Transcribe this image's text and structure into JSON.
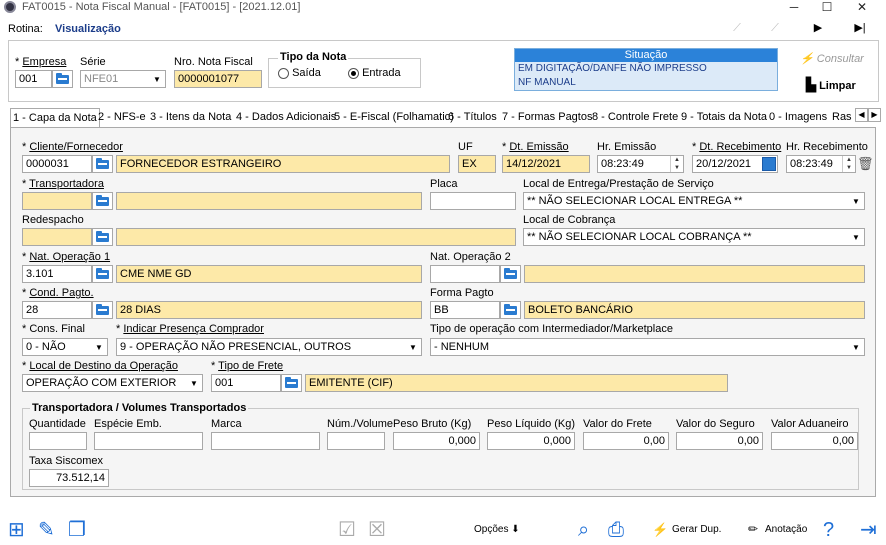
{
  "window": {
    "title": "FAT0015 - Nota Fiscal Manual - [FAT0015] - [2021.12.01]",
    "minimize": "─",
    "maximize": "☐",
    "close": "✕"
  },
  "rotina": {
    "label": "Rotina:",
    "value": "Visualização"
  },
  "nav": [
    "⟋",
    "⟋",
    "▶",
    "▶|"
  ],
  "header": {
    "empresa": {
      "label": "Empresa",
      "value": "001"
    },
    "serie": {
      "label": "Série",
      "value": "NFE01"
    },
    "nro": {
      "label": "Nro. Nota Fiscal",
      "value": "0000001077"
    },
    "tipo": {
      "title": "Tipo da Nota",
      "saida": "Saída",
      "entrada": "Entrada",
      "selected": "entrada"
    },
    "situacao": {
      "title": "Situação",
      "lines": [
        "EM DIGITAÇÃO/DANFE NÃO IMPRESSO",
        "NF MANUAL"
      ]
    },
    "consultar": "Consultar",
    "limpar": "Limpar"
  },
  "tabs": [
    "1 - Capa da Nota",
    "2 - NFS-e",
    "3 - Itens da Nota",
    "4 - Dados Adicionais",
    "5 - E-Fiscal (Folhamatic)",
    "6 - Títulos",
    "7 - Formas Pagtos",
    "8 - Controle Frete",
    "9 - Totais da Nota",
    "0 - Imagens",
    "Ras"
  ],
  "form": {
    "cliente": {
      "label": "Cliente/Fornecedor",
      "code": "0000031",
      "name": "FORNECEDOR ESTRANGEIRO"
    },
    "uf": {
      "label": "UF",
      "value": "EX"
    },
    "dt_emissao": {
      "label": "Dt. Emissão",
      "value": "14/12/2021"
    },
    "hr_emissao": {
      "label": "Hr. Emissão",
      "value": "08:23:49"
    },
    "dt_receb": {
      "label": "Dt. Recebimento",
      "value": "20/12/2021"
    },
    "hr_receb": {
      "label": "Hr. Recebimento",
      "value": "08:23:49"
    },
    "transportadora": {
      "label": "Transportadora",
      "code": "",
      "name": ""
    },
    "placa": {
      "label": "Placa",
      "value": ""
    },
    "local_entrega": {
      "label": "Local de Entrega/Prestação de Serviço",
      "value": "** NÃO SELECIONAR LOCAL ENTREGA **"
    },
    "redespacho": {
      "label": "Redespacho",
      "code": "",
      "name": ""
    },
    "local_cobranca": {
      "label": "Local de Cobrança",
      "value": "** NÃO SELECIONAR LOCAL COBRANÇA **"
    },
    "nat_op1": {
      "label": "Nat. Operação 1",
      "code": "3.101",
      "name": "CME NME GD"
    },
    "nat_op2": {
      "label": "Nat. Operação 2",
      "code": "",
      "name": ""
    },
    "cond_pagto": {
      "label": "Cond. Pagto.",
      "code": "28",
      "name": "28 DIAS"
    },
    "forma_pagto": {
      "label": "Forma Pagto",
      "code": "BB",
      "name": "BOLETO BANCÁRIO"
    },
    "cons_final": {
      "label": "Cons. Final",
      "value": "0 - NÃO"
    },
    "presenca": {
      "label": "Indicar Presença Comprador",
      "value": "9 - OPERAÇÃO NÃO PRESENCIAL, OUTROS"
    },
    "intermediador": {
      "label": "Tipo de operação com Intermediador/Marketplace",
      "value": "-   NENHUM"
    },
    "local_destino": {
      "label": "Local de Destino da Operação",
      "value": "OPERAÇÃO COM EXTERIOR"
    },
    "tipo_frete": {
      "label": "Tipo de Frete",
      "code": "001",
      "name": "EMITENTE (CIF)"
    }
  },
  "volumes": {
    "title": "Transportadora / Volumes Transportados",
    "quantidade": {
      "label": "Quantidade",
      "value": ""
    },
    "especie": {
      "label": "Espécie Emb.",
      "value": ""
    },
    "marca": {
      "label": "Marca",
      "value": ""
    },
    "num_volume": {
      "label": "Núm./Volume",
      "value": ""
    },
    "peso_bruto": {
      "label": "Peso Bruto (Kg)",
      "value": "0,000"
    },
    "peso_liquido": {
      "label": "Peso Líquido (Kg)",
      "value": "0,000"
    },
    "valor_frete": {
      "label": "Valor do Frete",
      "value": "0,00"
    },
    "valor_seguro": {
      "label": "Valor do Seguro",
      "value": "0,00"
    },
    "valor_aduaneiro": {
      "label": "Valor Aduaneiro",
      "value": "0,00"
    },
    "taxa": {
      "label": "Taxa Siscomex",
      "value": "73.512,14"
    }
  },
  "bottom": {
    "opcoes": "Opções ⬇",
    "gerar": "Gerar Dup.",
    "anotacao": "Anotação"
  }
}
